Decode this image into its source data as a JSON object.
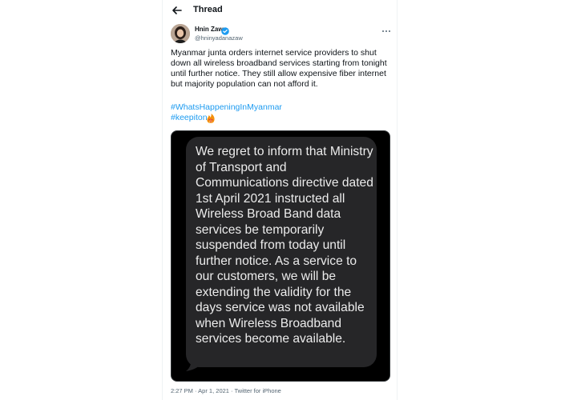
{
  "header": {
    "title": "Thread",
    "back_icon": "arrow-left-icon"
  },
  "author": {
    "display_name": "Hnin Zaw",
    "handle": "@hninyadanazaw",
    "verified": true,
    "verified_color": "#1d9bf0"
  },
  "tweet": {
    "text": "Myanmar junta orders internet service providers to shut down all wireless broadband services starting from tonight until further notice. They still allow expensive fiber internet but majority population can not afford it.",
    "hashtags": [
      "#WhatsHappeningInMyanmar",
      "#keepiton"
    ],
    "hashtag_color": "#1d9bf0",
    "emoji_icon": "fire-wifi-icon"
  },
  "media": {
    "message_text": "We regret to inform that Ministry of Transport and Communications directive dated 1st April 2021 instructed all Wireless Broad Band data services be temporarily suspended from today until further notice. As a service to our customers, we will be extending the validity for the days service was not available when Wireless Broadband services become available."
  },
  "footer": {
    "meta": "2:27 PM · Apr 1, 2021 · Twitter for iPhone"
  }
}
